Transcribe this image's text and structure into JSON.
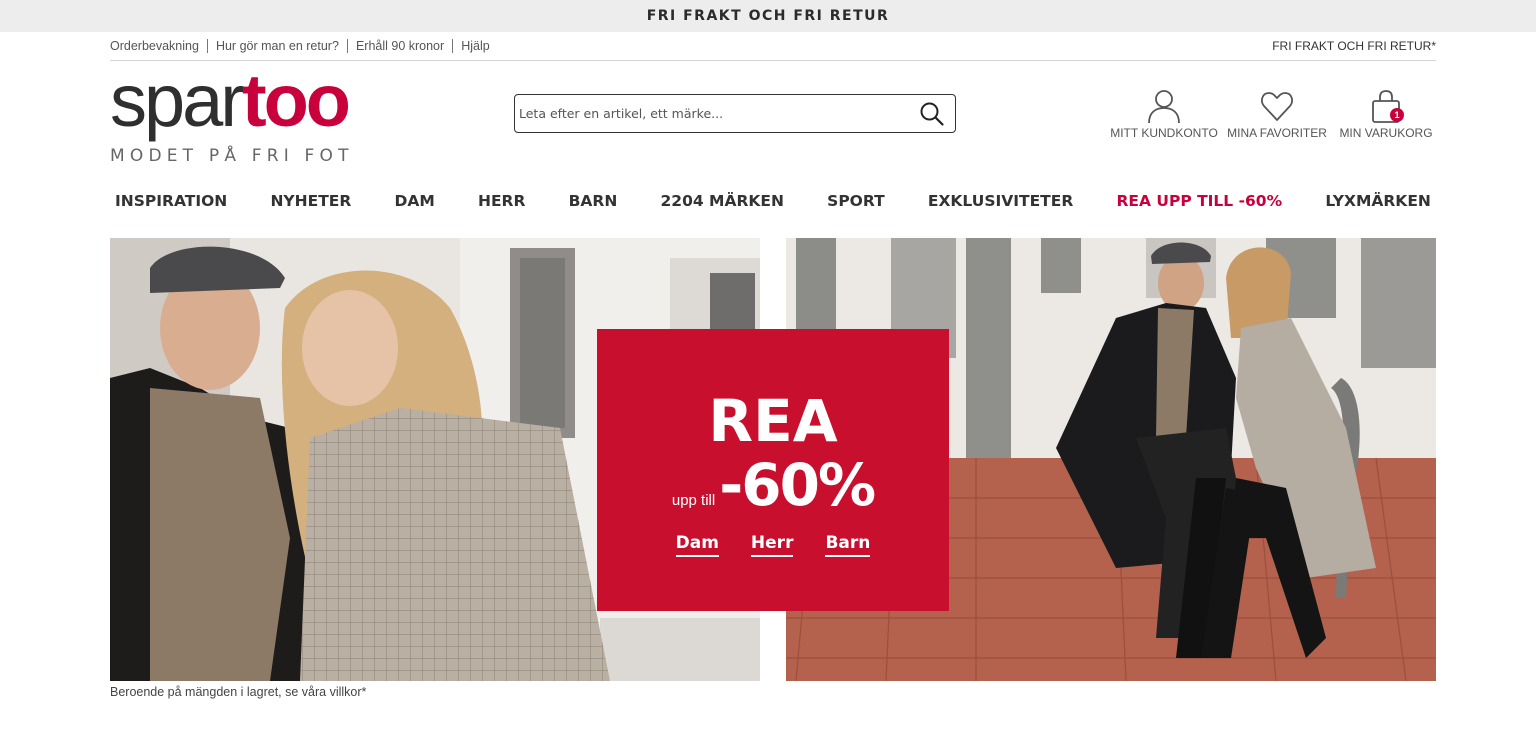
{
  "topbar": {
    "text": "FRI FRAKT OCH FRI RETUR"
  },
  "utility": {
    "links": [
      "Orderbevakning",
      "Hur gör man en retur?",
      "Erhåll 90 kronor",
      "Hjälp"
    ],
    "right_text": "FRI FRAKT OCH FRI RETUR*"
  },
  "logo": {
    "part1": "spar",
    "part2": "too",
    "tagline": "MODET PÅ FRI FOT"
  },
  "search": {
    "placeholder": "Leta efter en artikel, ett märke..."
  },
  "account": {
    "customer_label": "MITT KUNDKONTO",
    "favorites_label": "MINA FAVORITER",
    "cart_label": "MIN VARUKORG",
    "cart_count": "1"
  },
  "nav": {
    "items": [
      "INSPIRATION",
      "NYHETER",
      "DAM",
      "HERR",
      "BARN",
      "2204 MÄRKEN",
      "SPORT",
      "EXKLUSIVITETER",
      "REA UPP TILL -60%",
      "LYXMÄRKEN"
    ]
  },
  "promo": {
    "headline": "REA",
    "prefix": "upp till",
    "percent": "-60%",
    "categories": [
      "Dam",
      "Herr",
      "Barn"
    ]
  },
  "disclaimer": "Beroende på mängden i lagret, se våra villkor*",
  "colors": {
    "brand": "#c8003c",
    "promo_bg": "#c8102e",
    "topbar_bg": "#ededed"
  }
}
